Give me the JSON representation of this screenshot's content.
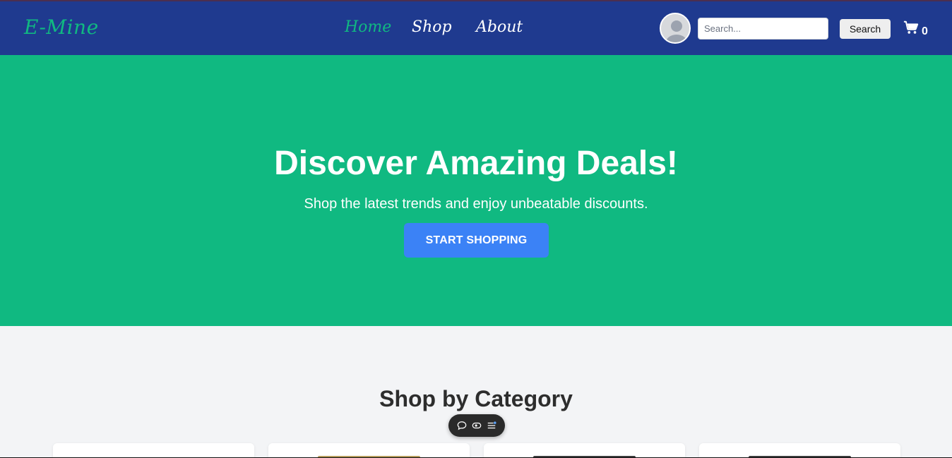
{
  "navbar": {
    "logo": "E-Mine",
    "links": [
      {
        "label": "Home",
        "active": true
      },
      {
        "label": "Shop",
        "active": false
      },
      {
        "label": "About",
        "active": false
      }
    ],
    "search": {
      "placeholder": "Search...",
      "value": "",
      "button_label": "Search"
    },
    "cart": {
      "icon": "cart-icon",
      "count": "0"
    },
    "avatar_icon": "user-avatar-icon"
  },
  "hero": {
    "title": "Discover Amazing Deals!",
    "subtitle": "Shop the latest trends and enjoy unbeatable discounts.",
    "cta_label": "START SHOPPING"
  },
  "categories": {
    "title": "Shop by Category"
  },
  "floating_toolbar": {
    "icons": [
      "chat-icon",
      "eye-icon",
      "list-icon"
    ]
  },
  "colors": {
    "navbar": "#1f3a8f",
    "accent_green": "#10b981",
    "cta_blue": "#3b82f6",
    "page_bg": "#f3f4f6"
  }
}
